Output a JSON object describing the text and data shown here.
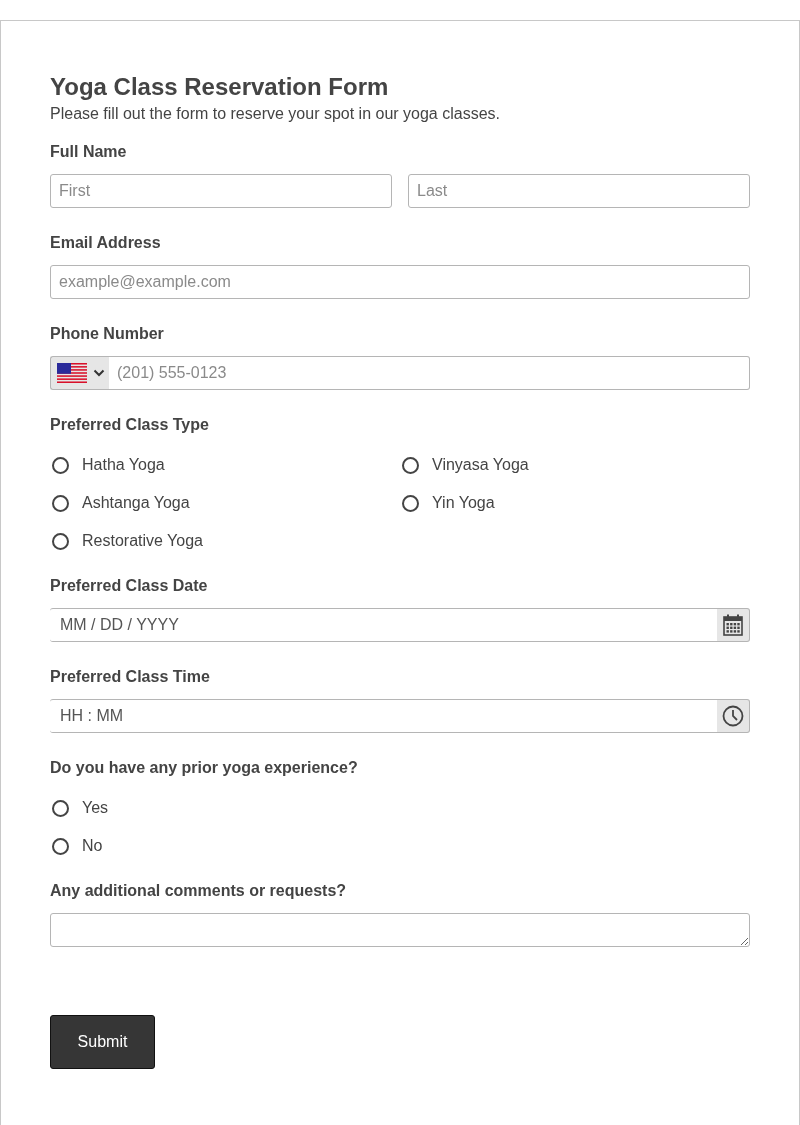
{
  "form": {
    "title": "Yoga Class Reservation Form",
    "subtitle": "Please fill out the form to reserve your spot in our yoga classes."
  },
  "fields": [
    {
      "kind": "name",
      "label": "Full Name",
      "placeholders": [
        "First",
        "Last"
      ]
    },
    {
      "kind": "text",
      "label": "Email Address",
      "placeholder": "example@example.com"
    },
    {
      "kind": "phone",
      "label": "Phone Number",
      "placeholder": "(201) 555-0123"
    },
    {
      "kind": "radio_grid",
      "label": "Preferred Class Type",
      "options": [
        {
          "label": "Hatha Yoga",
          "selected": false
        },
        {
          "label": "Vinyasa Yoga",
          "selected": false
        },
        {
          "label": "Ashtanga Yoga",
          "selected": false
        },
        {
          "label": "Yin Yoga",
          "selected": false
        },
        {
          "label": "Restorative Yoga",
          "selected": false
        }
      ]
    },
    {
      "kind": "date",
      "label": "Preferred Class Date",
      "placeholder": "MM / DD / YYYY"
    },
    {
      "kind": "time",
      "label": "Preferred Class Time",
      "placeholder": "HH : MM"
    },
    {
      "kind": "radio",
      "label": "Do you have any prior yoga experience?",
      "options": [
        {
          "label": "Yes",
          "selected": false
        },
        {
          "label": "No",
          "selected": false
        }
      ]
    },
    {
      "kind": "textarea",
      "label": "Any additional comments or requests?"
    }
  ],
  "submit": {
    "label": "Submit"
  }
}
